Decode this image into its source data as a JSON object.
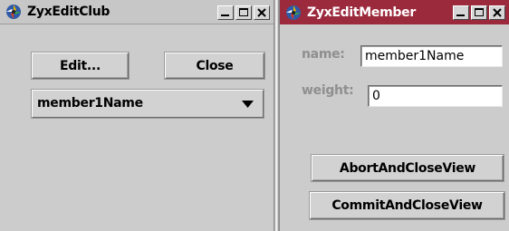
{
  "club_window": {
    "title": "ZyxEditClub",
    "app_icon": "java-cup-icon",
    "controls": [
      "minimize-icon",
      "maximize-icon",
      "close-icon"
    ],
    "edit_button": "Edit...",
    "close_button": "Close",
    "member_combo": {
      "selected": "member1Name"
    }
  },
  "member_window": {
    "title": "ZyxEditMember",
    "app_icon": "java-cup-icon",
    "title_bar_color": "#9c2a3d",
    "controls": [
      "minimize-icon",
      "maximize-icon",
      "close-icon"
    ],
    "name_label": "name:",
    "name_value": "member1Name",
    "weight_label": "weight:",
    "weight_value": "0",
    "abort_button": "AbortAndCloseView",
    "commit_button": "CommitAndCloseView"
  }
}
